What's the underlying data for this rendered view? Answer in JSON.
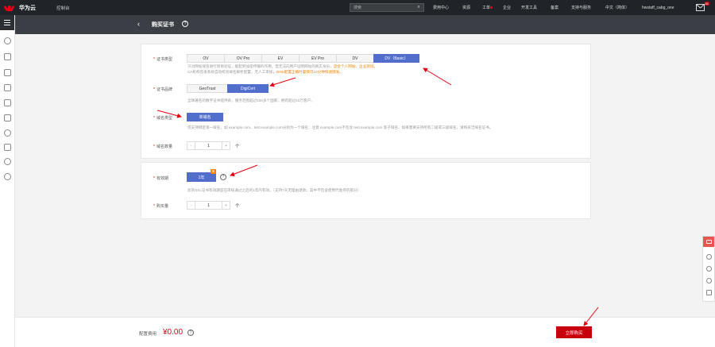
{
  "topbar": {
    "brand": "华为云",
    "console": "控制台",
    "search_placeholder": "搜索",
    "nav": [
      "费用中心",
      "资源",
      "工单",
      "企业",
      "开发工具",
      "备案",
      "支持与服务",
      "中文（简体）",
      "hwstaff_cabg_one"
    ],
    "mail_count": "61"
  },
  "page": {
    "title": "购买证书"
  },
  "form": {
    "cert_type": {
      "label": "证书类型",
      "options": [
        "OV",
        "OV Pro",
        "EV",
        "EV Pro",
        "DV",
        "DV（Basic）"
      ],
      "selected": "DV（Basic）",
      "desc_line1_a": "只对网站域名进行简易验证，能起到加密传输的作用，但无法向用户证明网站的真实身份，",
      "desc_line1_b": "适合个人网站、企业测试。",
      "desc_line2_a": "CA机构签发系统自动校验域名解析配置，无人工审核，",
      "desc_line2_b": "DNS配置正确时最快可10分钟快速颁发。"
    },
    "cert_brand": {
      "label": "证书品牌",
      "options": [
        "GeoTrust",
        "DigiCert"
      ],
      "selected": "DigiCert",
      "desc": "全球著名的数字证书提供商，服务范围超过150多个国家，拥有超过10万客户。"
    },
    "domain_type": {
      "label": "域名类型",
      "options": [
        "单域名"
      ],
      "selected": "单域名",
      "desc": "仅支持绑定单一域名，如 example.com、test.example.com分别为一个域名；注意 example.com不包含 test.example.com 等子域名，如果需要支持所有二级或三级域名，请购买泛域名证书。"
    },
    "domain_count": {
      "label": "域名数量",
      "value": "1",
      "unit": "个",
      "minus": "-",
      "plus": "+"
    },
    "validity": {
      "label": "有效期",
      "options": [
        "1年"
      ],
      "selected": "1年",
      "tag": "荐",
      "desc": "您的SSL证书有效期是在审核通过之后的1年内有效。（支持7天无理由退款，其中不包含使用代金券的部分）"
    },
    "quantity": {
      "label": "购买量",
      "value": "1",
      "unit": "个",
      "minus": "-",
      "plus": "+"
    }
  },
  "footer": {
    "fee_label": "配置费用",
    "fee_value": "¥0.00",
    "buy_label": "立即购买"
  },
  "colors": {
    "accent": "#526ecc",
    "brand_red": "#c7000b",
    "highlight": "#f08300"
  }
}
